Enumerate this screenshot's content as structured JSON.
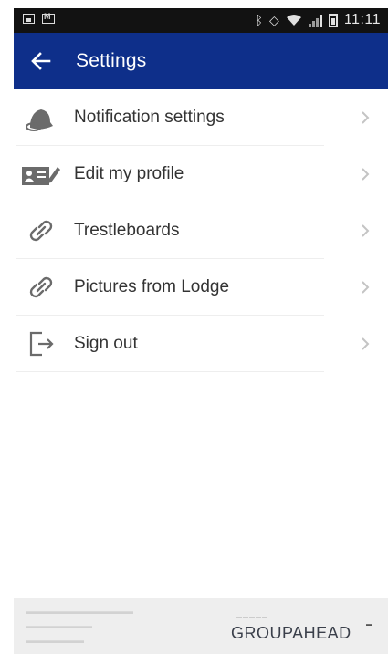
{
  "status_bar": {
    "time": "11:11"
  },
  "app_bar": {
    "title": "Settings"
  },
  "menu": {
    "items": [
      {
        "label": "Notification settings",
        "icon": "bell-icon"
      },
      {
        "label": "Edit my profile",
        "icon": "id-card-icon"
      },
      {
        "label": "Trestleboards",
        "icon": "link-icon"
      },
      {
        "label": "Pictures from Lodge",
        "icon": "link-icon"
      },
      {
        "label": "Sign out",
        "icon": "sign-out-icon"
      }
    ]
  },
  "footer": {
    "brand": "GROUPAHEAD"
  },
  "colors": {
    "app_bar": "#0e2f8a",
    "status_bar": "#121212",
    "text": "#333333",
    "icon": "#6b6b6b",
    "footer": "#eeeeee"
  }
}
